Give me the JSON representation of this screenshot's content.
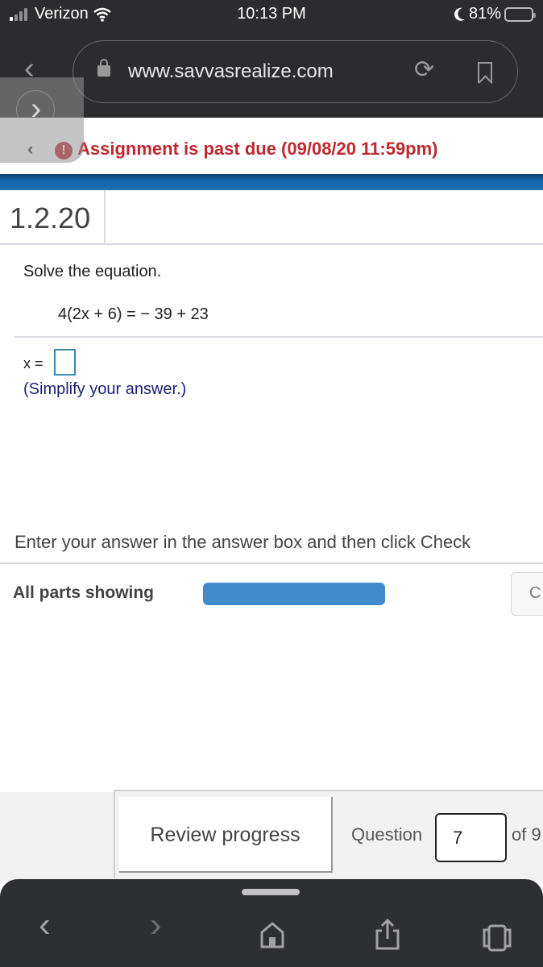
{
  "status_bar": {
    "carrier": "Verizon",
    "time": "10:13 PM",
    "battery_percent": "81%",
    "signal_bars_active": 1,
    "signal_bars_total": 4,
    "battery_level": 0.81
  },
  "browser": {
    "url": "www.savvasrealize.com",
    "icons": {
      "lock": "lock-icon",
      "reload": "reload-icon",
      "bookmark": "bookmark-icon",
      "back": "chevron-left-icon"
    },
    "reload_glyph": "⟳",
    "back_glyph": "‹",
    "swipe_forward_glyph": "›"
  },
  "notice": {
    "back_glyph": "‹",
    "icon_glyph": "!",
    "text": "Assignment is past due (09/08/20 11:59pm)",
    "color": "#c0282f"
  },
  "question": {
    "number": "1.2.20",
    "prompt": "Solve the equation.",
    "equation": "4(2x + 6) = − 39 + 23",
    "answer_label": "x =",
    "answer_value": "",
    "hint": "(Simplify your answer.)"
  },
  "instructions": "Enter your answer in the answer box and then click Check",
  "parts": {
    "label": "All parts showing",
    "progress_fraction": 1.0,
    "progress_color": "#418bca"
  },
  "check_button": {
    "label": "C"
  },
  "footer": {
    "review_label": "Review progress",
    "question_label": "Question",
    "question_value": "7",
    "question_total": "of 9"
  },
  "toolbar": {
    "back_glyph": "‹",
    "forward_glyph": "›"
  }
}
